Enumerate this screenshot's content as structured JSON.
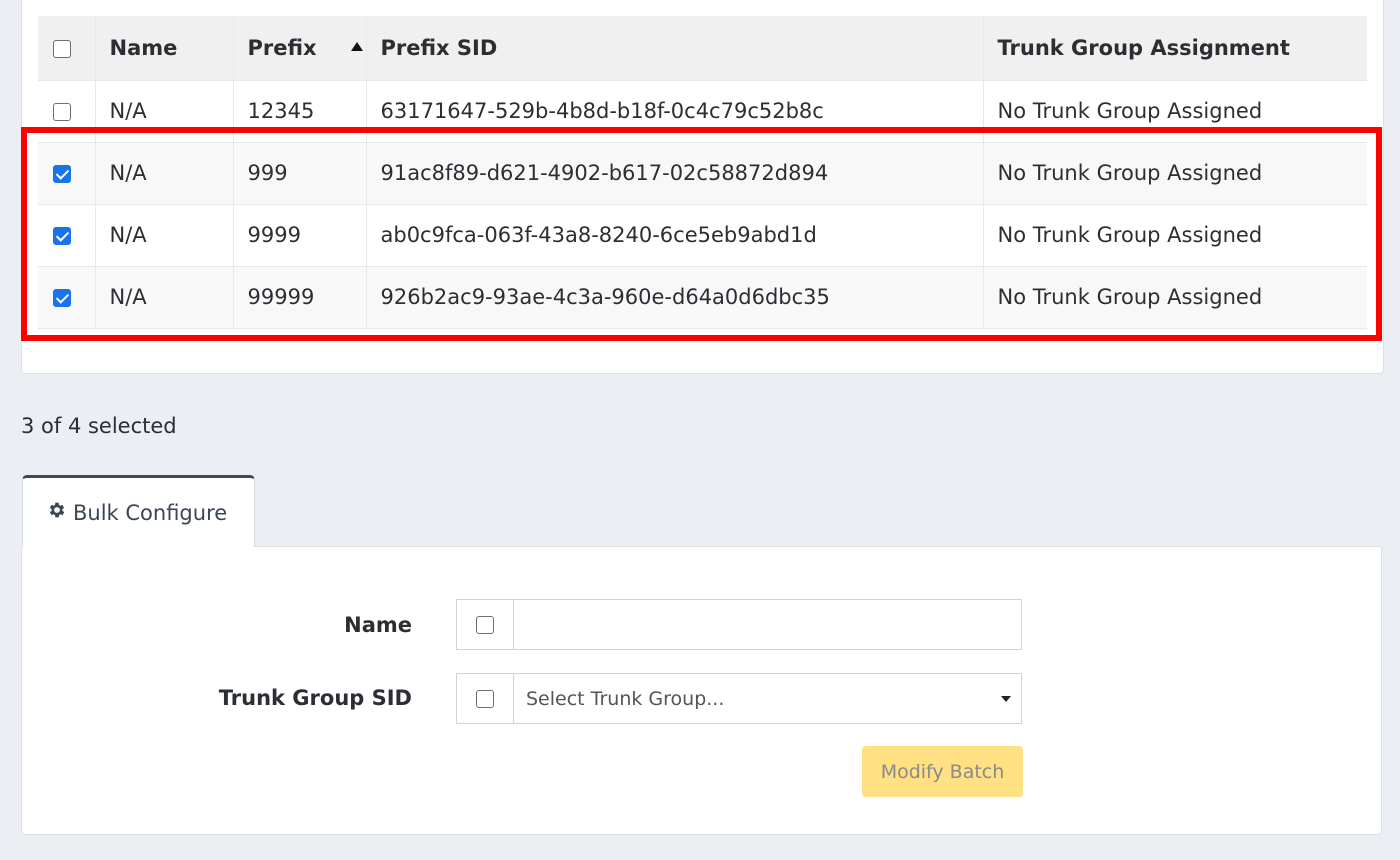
{
  "table": {
    "columns": [
      "Name",
      "Prefix",
      "Prefix SID",
      "Trunk Group Assignment"
    ],
    "rows": [
      {
        "checked": false,
        "name": "N/A",
        "prefix": "12345",
        "sid": "63171647-529b-4b8d-b18f-0c4c79c52b8c",
        "trunk": "No Trunk Group Assigned"
      },
      {
        "checked": true,
        "name": "N/A",
        "prefix": "999",
        "sid": "91ac8f89-d621-4902-b617-02c58872d894",
        "trunk": "No Trunk Group Assigned"
      },
      {
        "checked": true,
        "name": "N/A",
        "prefix": "9999",
        "sid": "ab0c9fca-063f-43a8-8240-6ce5eb9abd1d",
        "trunk": "No Trunk Group Assigned"
      },
      {
        "checked": true,
        "name": "N/A",
        "prefix": "99999",
        "sid": "926b2ac9-93ae-4c3a-960e-d64a0d6dbc35",
        "trunk": "No Trunk Group Assigned"
      }
    ]
  },
  "selection": {
    "summary": "3 of 4 selected"
  },
  "bulk": {
    "tab_label": "Bulk Configure",
    "tab_icon": "gear-icon",
    "name_label": "Name",
    "name_value": "",
    "trunk_label": "Trunk Group SID",
    "trunk_placeholder": "Select Trunk Group...",
    "submit_label": "Modify Batch"
  },
  "colors": {
    "highlight": "#ff0000",
    "checkbox": "#1a73e8",
    "button": "#ffe082"
  }
}
